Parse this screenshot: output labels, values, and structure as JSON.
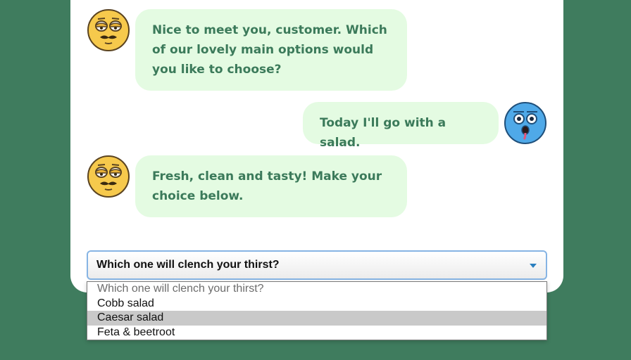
{
  "chat": {
    "messages": [
      {
        "from": "bot",
        "avatar": "mustache-smiley-icon",
        "text": "Nice to meet you, customer. Which\nof our lovely main options would\nyou like to choose?"
      },
      {
        "from": "user",
        "avatar": "surprised-blue-face-icon",
        "text": "Today I'll go with a salad."
      },
      {
        "from": "bot",
        "avatar": "mustache-smiley-icon",
        "text": "Fresh, clean and tasty! Make your\nchoice below."
      }
    ]
  },
  "select": {
    "current": "Which one will clench your thirst?",
    "options": [
      "Which one will clench your thirst?",
      "Cobb salad",
      "Caesar salad",
      "Feta & beetroot"
    ],
    "highlighted": "Caesar salad",
    "caret_icon": "chevron-down-icon"
  },
  "colors": {
    "background": "#3f7c5e",
    "bubble": "#e4fbe2",
    "bubble_text": "#3b7a5a",
    "focus_border": "#86b4e4",
    "highlight": "#c9c9c9"
  }
}
